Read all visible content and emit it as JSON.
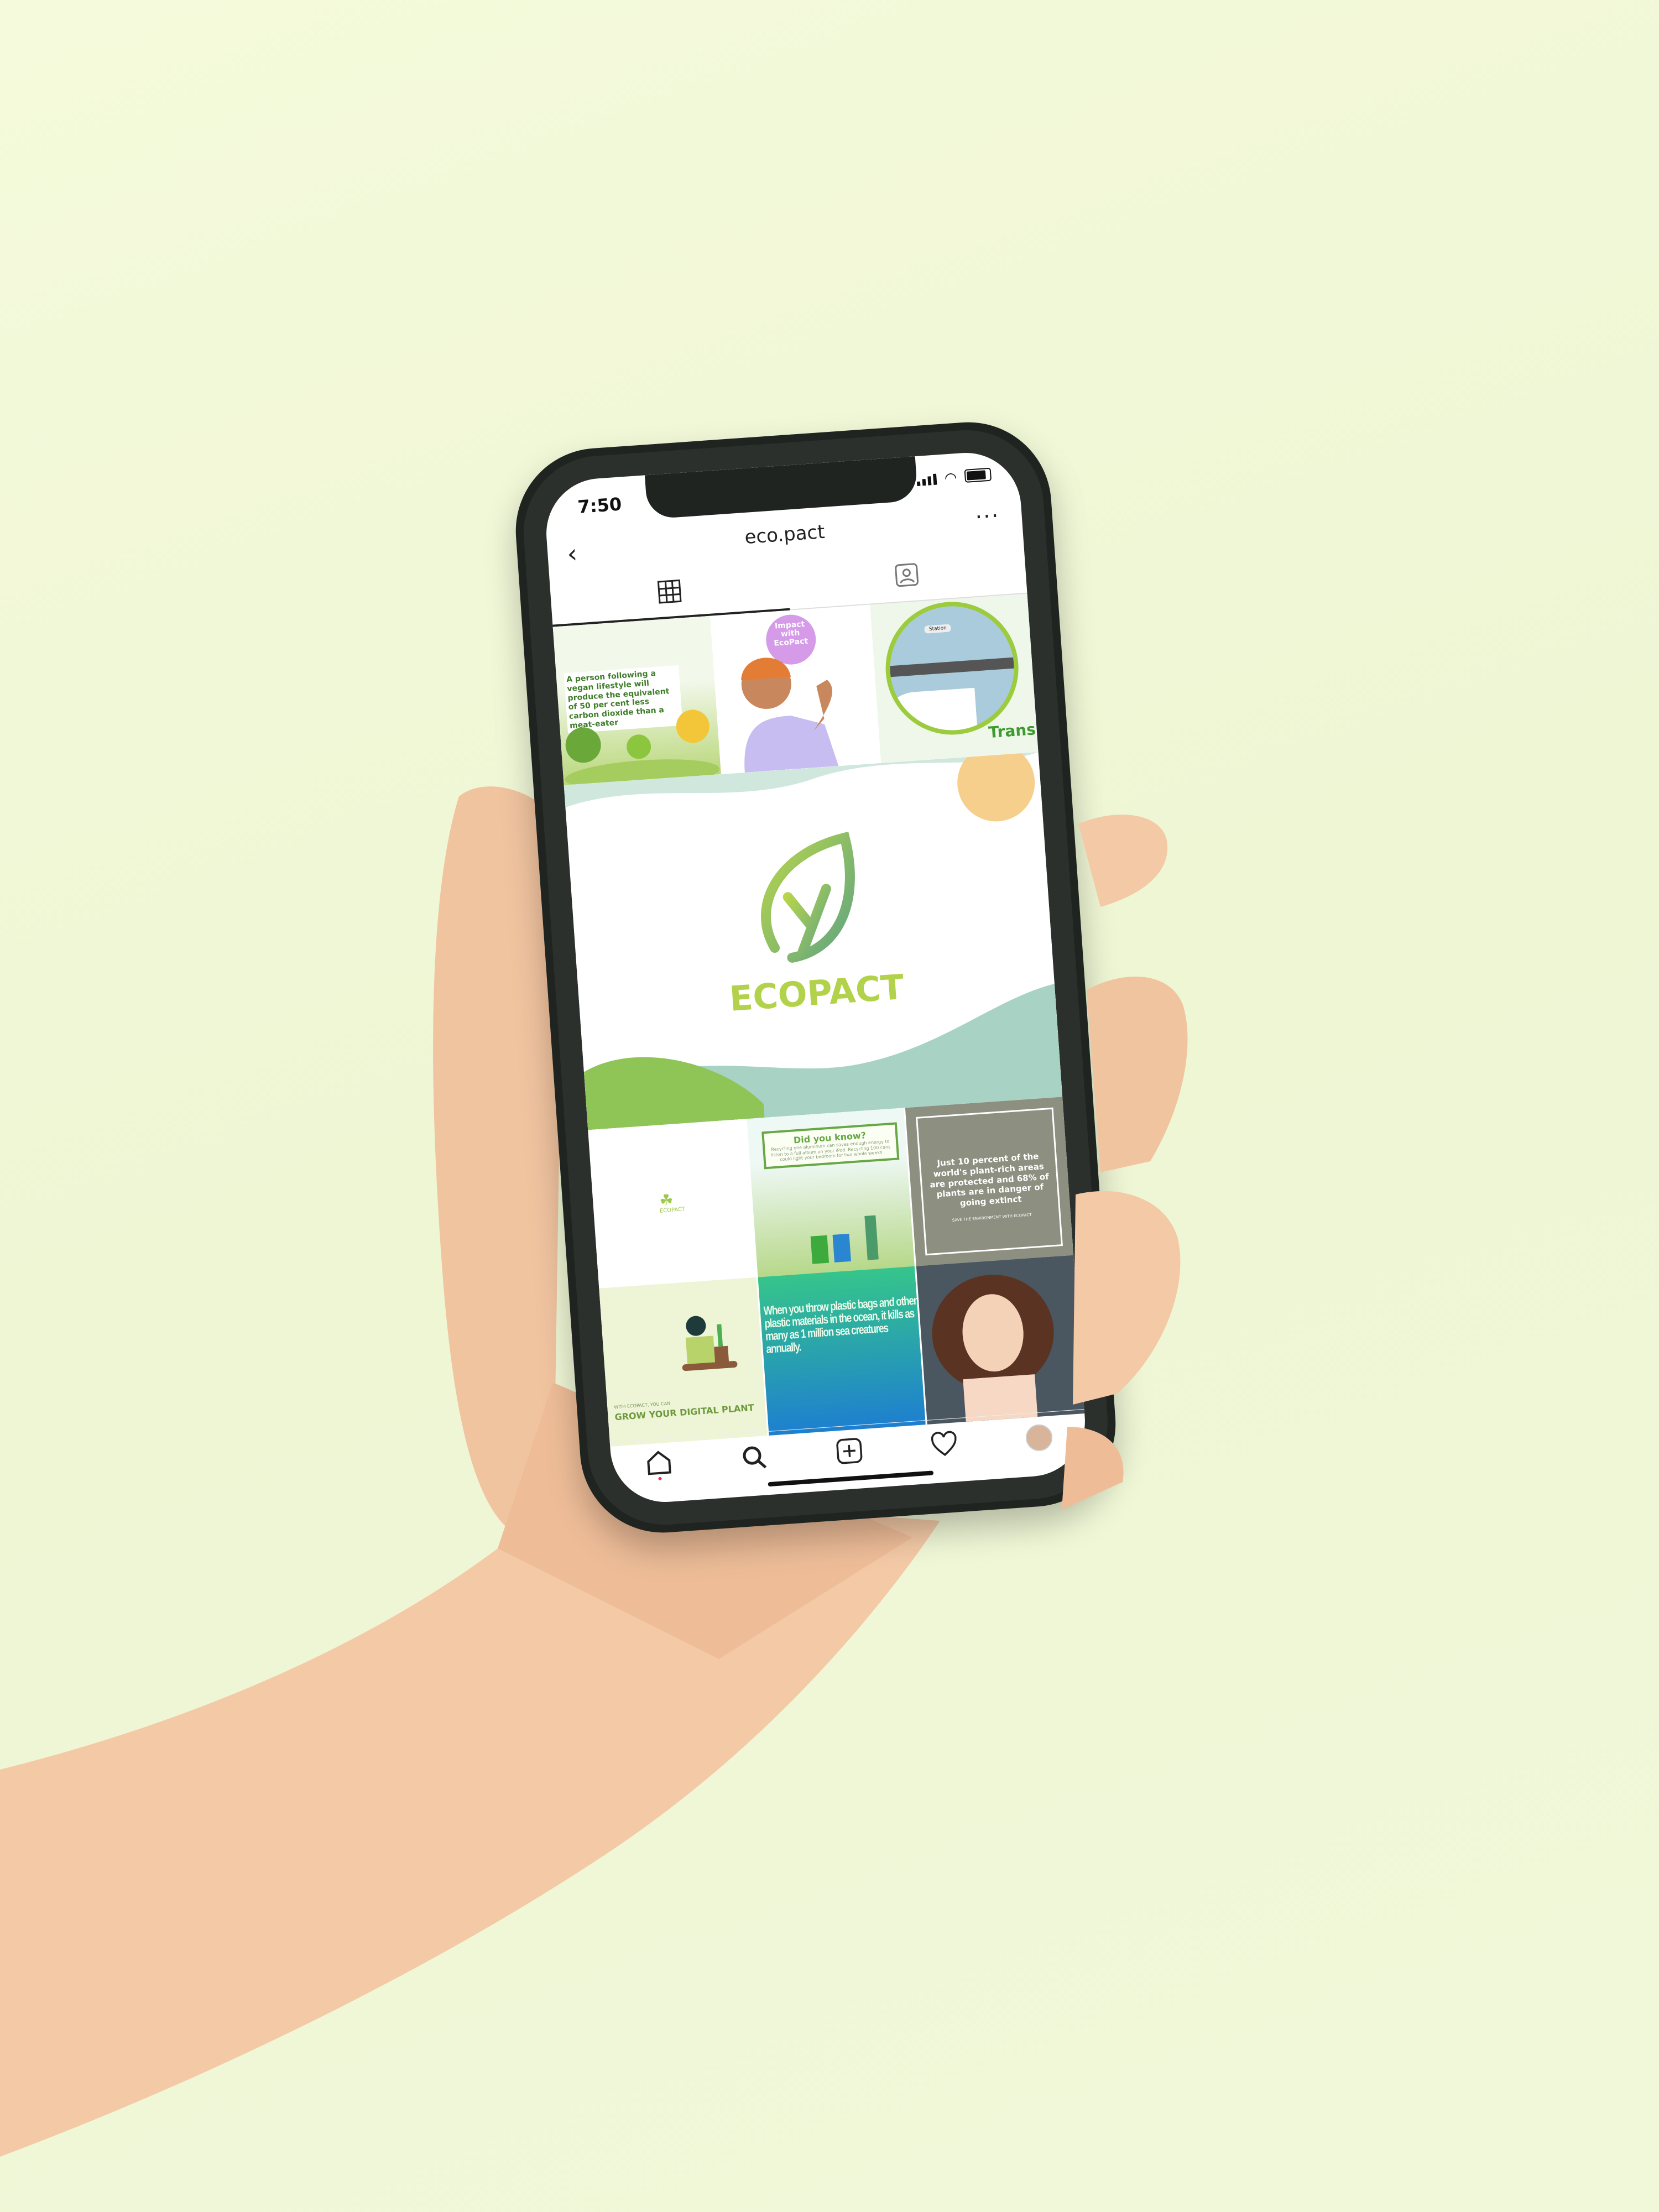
{
  "status_bar": {
    "time": "7:50"
  },
  "header": {
    "title": "eco.pact",
    "back_icon": "chevron-left-icon",
    "more_icon": "ellipsis-icon"
  },
  "tabs": [
    {
      "icon": "grid-icon",
      "active": true
    },
    {
      "icon": "tagged-person-icon",
      "active": false
    }
  ],
  "posts": {
    "vegan": {
      "text": "A person following a vegan lifestyle will produce the equivalent of 50 per cent less carbon dioxide than a meat-eater"
    },
    "impact": {
      "text": "Impact with EcoPact"
    },
    "transport": {
      "text": "Trans",
      "station": "Station"
    },
    "logo": {
      "text": "ECOPACT"
    },
    "mini_logo": {
      "text": "ECOPACT"
    },
    "did_you_know": {
      "title": "Did you know?",
      "body": "Recycling one aluminum can saves enough energy to listen to a full album on your iPod. Recycling 100 cans could light your bedroom for two whole weeks"
    },
    "plants": {
      "text": "Just 10 percent of the world's plant-rich areas are protected and 68% of plants are in danger of going extinct",
      "sub": "SAVE THE ENVIRONMENT WITH ECOPACT"
    },
    "grow": {
      "small": "WITH ECOPACT, YOU CAN",
      "title": "GROW YOUR DIGITAL PLANT"
    },
    "plastic": {
      "text": "When you throw plastic bags and other plastic materials in the ocean, it kills as many as 1 million sea creatures annually."
    }
  },
  "bottom_nav": [
    "home-icon",
    "search-icon",
    "add-post-icon",
    "heart-icon",
    "profile-avatar"
  ],
  "colors": {
    "background": "#f2f9d8",
    "brand_green": "#b3d24b",
    "phone_case": "#1f2420",
    "skin": "#f3c9a6"
  }
}
